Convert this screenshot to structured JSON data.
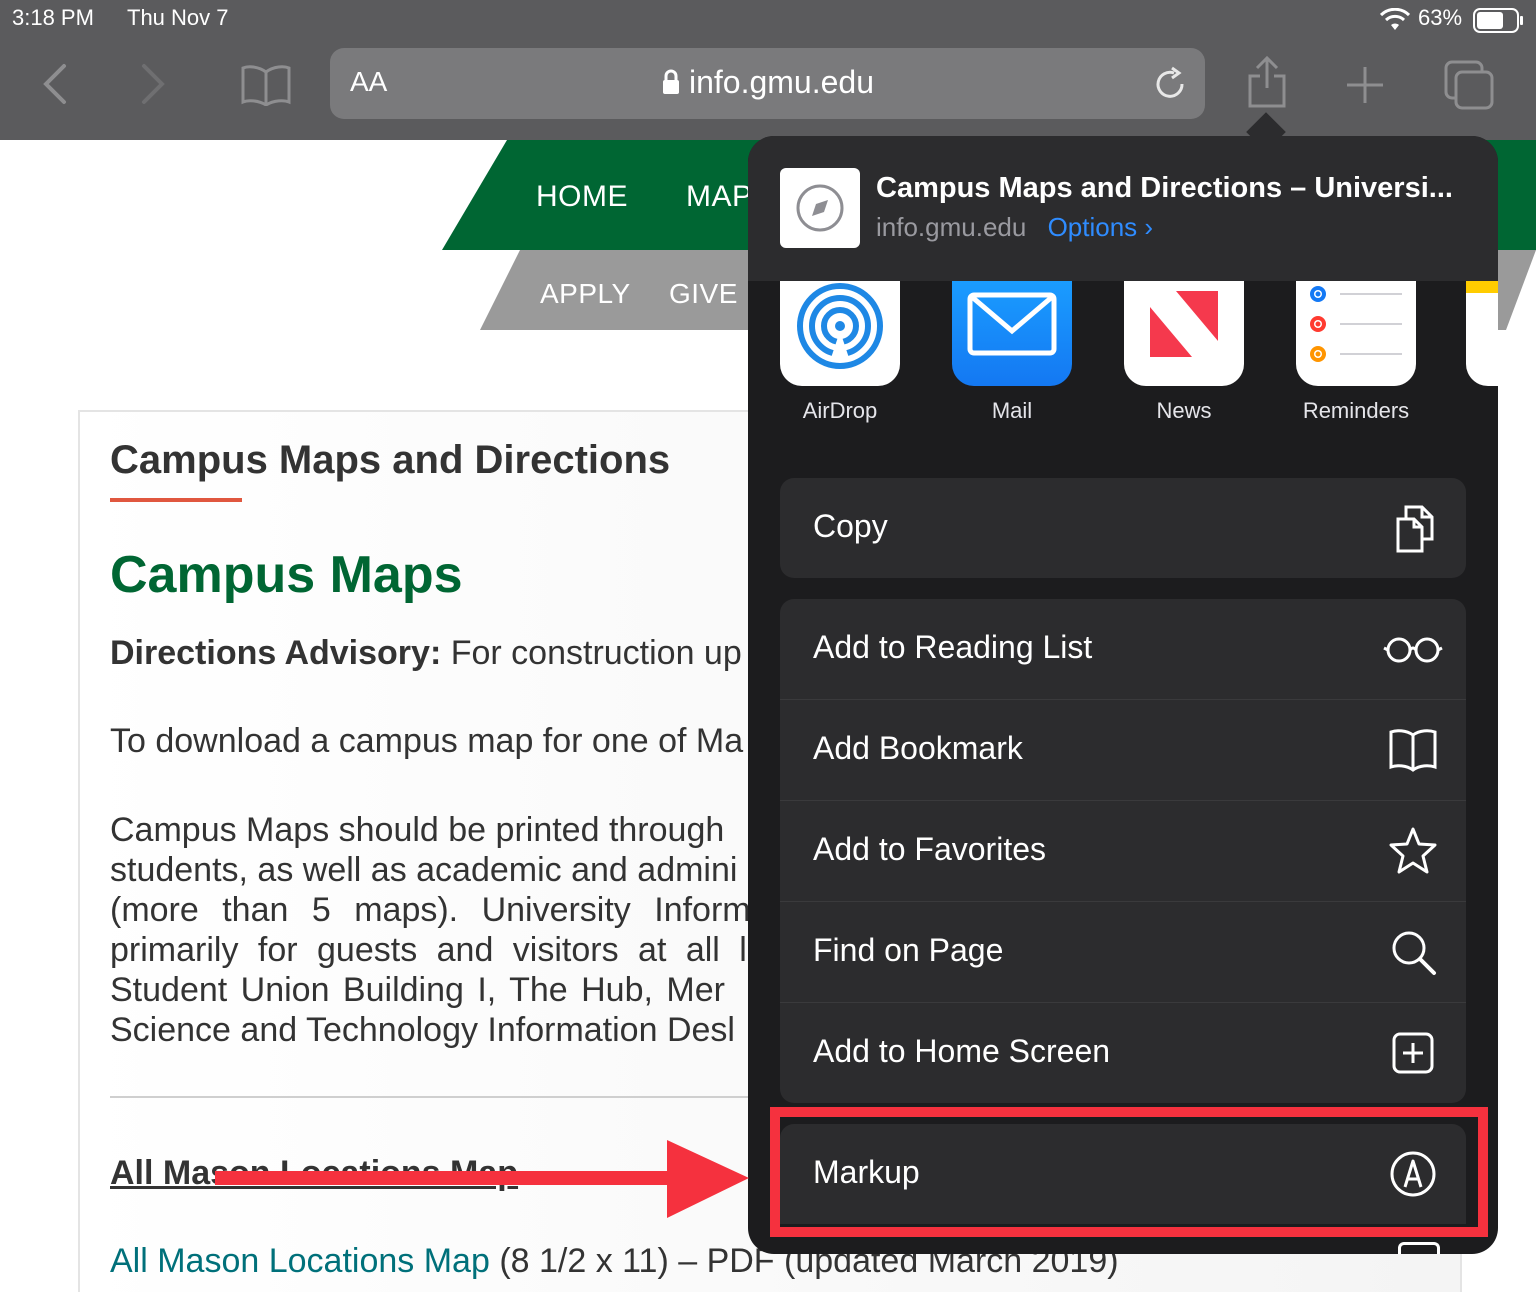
{
  "status_bar": {
    "time": "3:18 PM",
    "date": "Thu Nov 7",
    "battery": "63%"
  },
  "toolbar": {
    "reader_label": "AA",
    "url": "info.gmu.edu"
  },
  "site_nav": {
    "primary": [
      "HOME",
      "MAPS"
    ],
    "secondary": [
      "APPLY",
      "GIVE"
    ]
  },
  "page": {
    "section_title": "Campus Maps and Directions",
    "heading": "Campus Maps",
    "advisory_label": "Directions Advisory:",
    "advisory_text": " For construction up",
    "download_text": "To download a campus map for one of Ma",
    "para_lines": [
      "Campus Maps should be printed through",
      "students, as well as academic and admini",
      "(more than 5 maps). University Inform",
      "primarily for guests and visitors at all l",
      "Student Union Building I, The Hub, Mer",
      "Science and Technology Information Desl"
    ],
    "map_heading": "All Mason Locations Map",
    "map_link": "All Mason Locations Map",
    "map_info": " (8 1/2 x 11) – PDF (updated March 2019)"
  },
  "share_sheet": {
    "title": "Campus Maps and Directions – Universi...",
    "domain": "info.gmu.edu",
    "options_label": "Options",
    "apps": [
      {
        "label": "AirDrop",
        "icon": "airdrop-icon"
      },
      {
        "label": "Mail",
        "icon": "mail-icon"
      },
      {
        "label": "News",
        "icon": "news-icon"
      },
      {
        "label": "Reminders",
        "icon": "reminders-icon"
      }
    ],
    "copy_label": "Copy",
    "actions": [
      {
        "label": "Add to Reading List",
        "icon": "glasses-icon"
      },
      {
        "label": "Add Bookmark",
        "icon": "book-icon"
      },
      {
        "label": "Add to Favorites",
        "icon": "star-icon"
      },
      {
        "label": "Find on Page",
        "icon": "magnifier-icon"
      },
      {
        "label": "Add to Home Screen",
        "icon": "plus-square-icon"
      }
    ],
    "markup_label": "Markup"
  },
  "annotation": {
    "highlight_color": "#f5313e",
    "arrow_color": "#f5313e"
  },
  "colors": {
    "gmu_green": "#006633",
    "link_teal": "#00707a",
    "ios_blue": "#2f8cff"
  }
}
